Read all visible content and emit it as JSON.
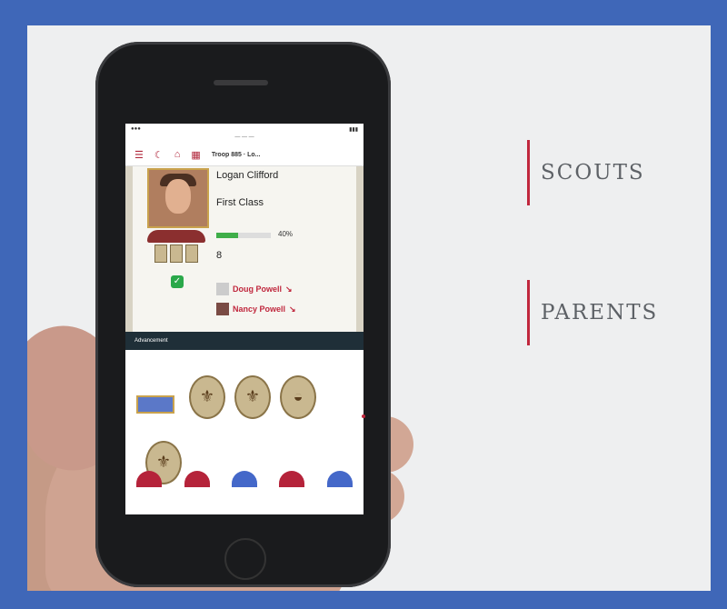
{
  "labels": {
    "scouts": "SCOUTS",
    "parents": "PARENTS"
  },
  "phone": {
    "navbar": {
      "troop": "Troop 885 · Lo..."
    },
    "profile": {
      "name": "Logan Clifford",
      "rank": "First Class",
      "progress_percent": 40,
      "progress_text": "40%",
      "count": "8",
      "guardians": [
        "Doug Powell",
        "Nancy Powell"
      ]
    },
    "advancement_header": "Advancement"
  },
  "colors": {
    "frame": "#3f67b8",
    "accent_red": "#c0273d",
    "progress_green": "#3fae49",
    "adv_header": "#1f2f38"
  }
}
